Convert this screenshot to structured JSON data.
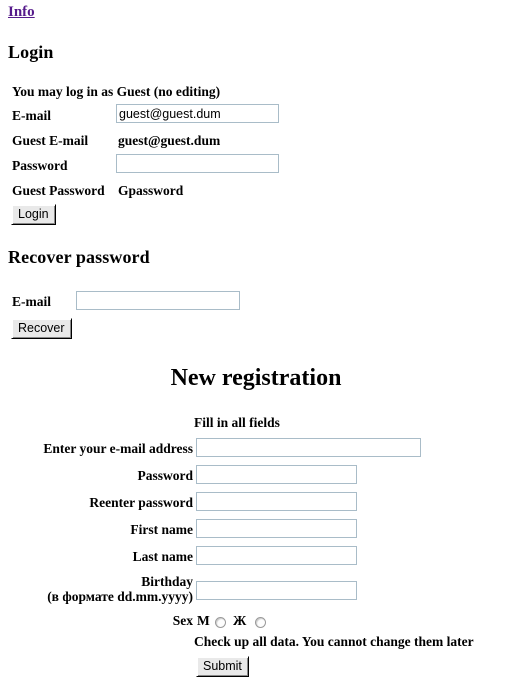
{
  "top_nav": {
    "info_link": "Info"
  },
  "login_section": {
    "heading": "Login",
    "note": "You may log in as Guest (no editing)",
    "email_label": "E-mail",
    "email_value": "guest@guest.dum",
    "email_placeholder": "",
    "guest_email_label": "Guest E-mail",
    "guest_email_value": "guest@guest.dum",
    "password_label": "Password",
    "password_value": "",
    "password_placeholder": "",
    "guest_password_label": "Guest Password",
    "guest_password_value": "Gpassword",
    "login_button": "Login"
  },
  "recover_section": {
    "heading": "Recover password",
    "email_label": "E-mail",
    "email_value": "",
    "email_placeholder": "",
    "recover_button": "Recover"
  },
  "registration_section": {
    "heading": "New registration",
    "fill_note": "Fill in all fields",
    "fields": [
      {
        "label": "Enter your e-mail address",
        "value": "",
        "name": "registration-email-input"
      },
      {
        "label": "Password",
        "value": "",
        "name": "registration-password-input"
      },
      {
        "label": "Reenter password",
        "value": "",
        "name": "registration-reenter-password-input"
      },
      {
        "label": "First name",
        "value": "",
        "name": "registration-first-name-input"
      },
      {
        "label": "Last name",
        "value": "",
        "name": "registration-last-name-input"
      }
    ],
    "birthday_label_line1": "Birthday",
    "birthday_label_line2": "(в формате dd.mm.yyyy)",
    "birthday_value": "",
    "sex_label": "Sex",
    "sex_options": [
      {
        "label": "М",
        "selected": false
      },
      {
        "label": "Ж",
        "selected": false
      }
    ],
    "check_note": "Check up all data. You cannot change them later",
    "submit_button": "Submit"
  },
  "colors": {
    "link_visited": "#551a8b",
    "input_border": "#a9bcc8",
    "button_face": "#e9e9e9",
    "text": "#000000",
    "background": "#ffffff"
  }
}
